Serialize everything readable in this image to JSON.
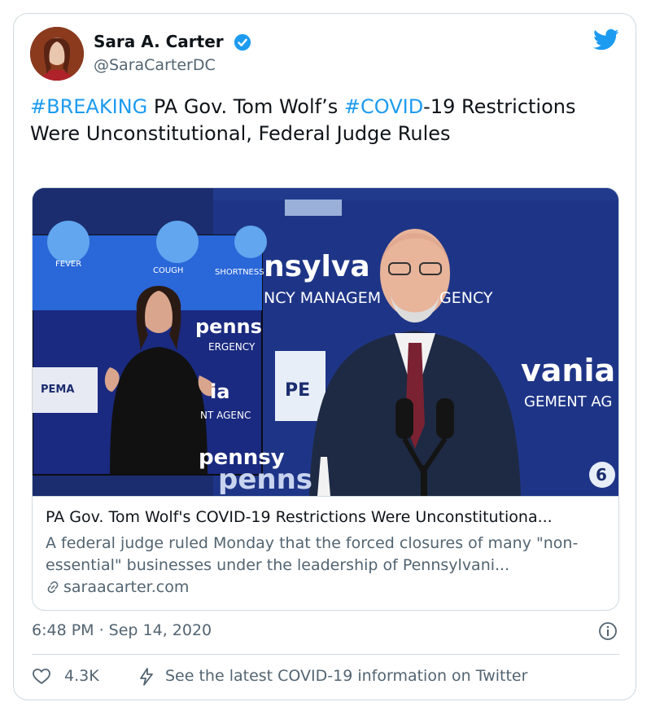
{
  "author": {
    "name": "Sara A. Carter",
    "handle": "@SaraCarterDC"
  },
  "tweet": {
    "hashtag1": "#BREAKING",
    "text1": " PA Gov. Tom Wolf’s ",
    "hashtag2": "#COVID",
    "text2": "-19 Restrictions Were Unconstitutional, Federal Judge Rules"
  },
  "card": {
    "title": "PA Gov. Tom Wolf's COVID-19 Restrictions Were Unconstitutiona...",
    "description": "A federal judge ruled Monday that the forced closures of many \"non-essential\" businesses under the leadership of Pennsylvani...",
    "domain": "saraacarter.com",
    "image_text": {
      "fever": "FEVER",
      "cough": "COUGH",
      "shortness": "SHORTNESS",
      "nsylva": "nsylva",
      "ncy_management": "NCY MANAGEM",
      "gency": "GENCY",
      "penns_small": "penns",
      "ergency": "ERGENCY",
      "pema": "PEMA",
      "pe_logo": "PE",
      "ia": "ia",
      "nt_agency": "NT AGENC",
      "vania": "vania",
      "gement_ag": "GEMENT AG",
      "pennsy": "pennsy",
      "penns_bottom": "penns",
      "channel": "6"
    }
  },
  "meta": {
    "timestamp": "6:48 PM · Sep 14, 2020",
    "likes": "4.3K",
    "covid_info": "See the latest COVID-19 information on Twitter"
  },
  "colors": {
    "accent": "#1d9bf0",
    "text": "#0f1419",
    "muted": "#536471",
    "border": "#cfd9de"
  }
}
